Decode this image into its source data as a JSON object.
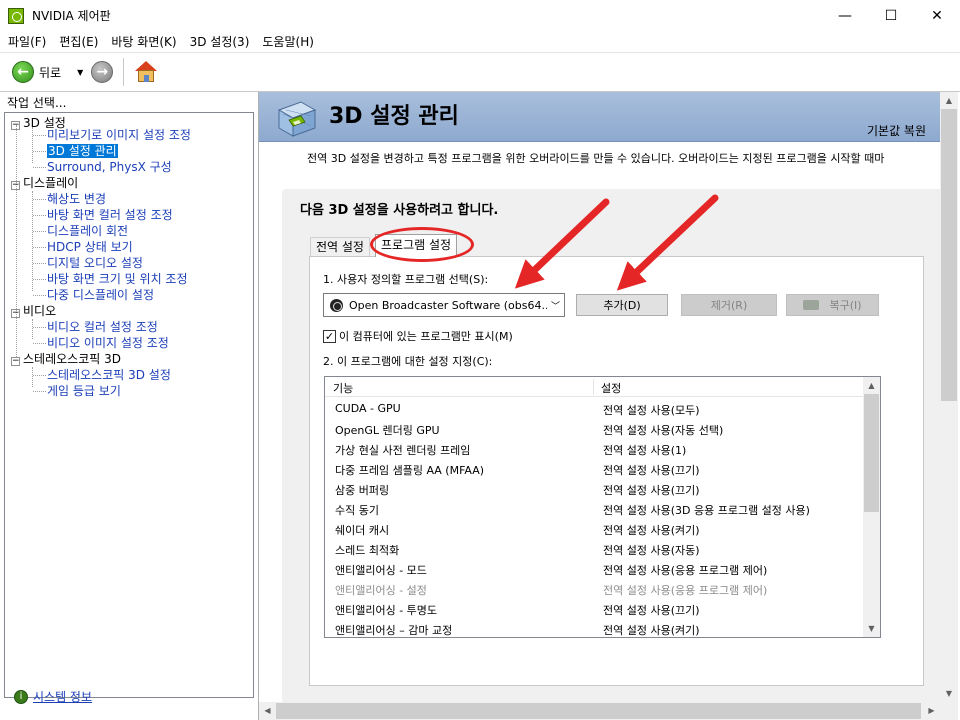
{
  "window": {
    "title": "NVIDIA 제어판",
    "minimize": "—",
    "maximize": "☐",
    "close": "✕"
  },
  "menu": {
    "items": [
      "파일(F)",
      "편집(E)",
      "바탕 화면(K)",
      "3D 설정(3)",
      "도움말(H)"
    ]
  },
  "toolbar": {
    "back_label": "뒤로",
    "back_glyph": "←",
    "forward_glyph": "→",
    "dropdown_glyph": "▼"
  },
  "sidebar": {
    "header": "작업 선택...",
    "categories": [
      {
        "label": "3D 설정",
        "toggle": "−",
        "children": [
          "미리보기로 이미지 설정 조정",
          "3D 설정 관리",
          "Surround, PhysX 구성"
        ]
      },
      {
        "label": "디스플레이",
        "toggle": "−",
        "children": [
          "해상도 변경",
          "바탕 화면 컬러 설정 조정",
          "디스플레이 회전",
          "HDCP 상태 보기",
          "디지털 오디오 설정",
          "바탕 화면 크기 및 위치 조정",
          "다중 디스플레이 설정"
        ]
      },
      {
        "label": "비디오",
        "toggle": "−",
        "children": [
          "비디오 컬러 설정 조정",
          "비디오 이미지 설정 조정"
        ]
      },
      {
        "label": "스테레오스코픽 3D",
        "toggle": "−",
        "children": [
          "스테레오스코픽 3D 설정",
          "게임 등급 보기"
        ]
      }
    ],
    "selected_item": "3D 설정 관리",
    "system_info": "시스템 정보",
    "system_info_glyph": "i"
  },
  "main": {
    "banner_title": "3D 설정 관리",
    "restore_defaults": "기본값 복원",
    "description": "전역 3D 설정을 변경하고 특정 프로그램을 위한 오버라이드를 만들 수 있습니다. 오버라이드는 지정된 프로그램을 시작할 때마",
    "section_title": "다음 3D 설정을 사용하려고 합니다.",
    "tabs": [
      {
        "label": "전역 설정",
        "active": false
      },
      {
        "label": "프로그램 설정",
        "active": true
      }
    ],
    "step1_label": "1. 사용자 정의할 프로그램 선택(S):",
    "program_select_value": "Open Broadcaster Software (obs64....",
    "select_arrow": "﹀",
    "add_button": "추가(D)",
    "remove_button": "제거(R)",
    "restore_button": "복구(I)",
    "checkbox_label": "이 컴퓨터에 있는 프로그램만 표시(M)",
    "checkbox_checked": "✓",
    "step2_label": "2. 이 프로그램에 대한 설정 지정(C):",
    "table": {
      "headers": [
        "기능",
        "설정"
      ],
      "rows": [
        {
          "feature": "CUDA - GPU",
          "setting": "전역 설정 사용(모두)",
          "disabled": false
        },
        {
          "feature": "OpenGL 렌더링 GPU",
          "setting": "전역 설정 사용(자동 선택)",
          "disabled": false
        },
        {
          "feature": "가상 현실 사전 렌더링 프레임",
          "setting": "전역 설정 사용(1)",
          "disabled": false
        },
        {
          "feature": "다중 프레임 샘플링 AA (MFAA)",
          "setting": "전역 설정 사용(끄기)",
          "disabled": false
        },
        {
          "feature": "삼중 버퍼링",
          "setting": "전역 설정 사용(끄기)",
          "disabled": false
        },
        {
          "feature": "수직 동기",
          "setting": "전역 설정 사용(3D 응용 프로그램 설정 사용)",
          "disabled": false
        },
        {
          "feature": "쉐이더 캐시",
          "setting": "전역 설정 사용(켜기)",
          "disabled": false
        },
        {
          "feature": "스레드 최적화",
          "setting": "전역 설정 사용(자동)",
          "disabled": false
        },
        {
          "feature": "앤티앨리어싱 - 모드",
          "setting": "전역 설정 사용(응용 프로그램 제어)",
          "disabled": false
        },
        {
          "feature": "앤티앨리어싱 - 설정",
          "setting": "전역 설정 사용(응용 프로그램 제어)",
          "disabled": true
        },
        {
          "feature": "앤티앨리어싱 - 투명도",
          "setting": "전역 설정 사용(끄기)",
          "disabled": false
        },
        {
          "feature": "앤티앨리어싱 – 감마 교정",
          "setting": "전역 설정 사용(켜기)",
          "disabled": false
        }
      ]
    }
  },
  "scroll_glyphs": {
    "up": "▲",
    "down": "▼",
    "left": "◀",
    "right": "▶"
  },
  "colors": {
    "annotation_red": "#e42726",
    "selection_blue": "#0078d7",
    "link_blue": "#1c3fb8",
    "nvidia_green": "#76b900"
  }
}
